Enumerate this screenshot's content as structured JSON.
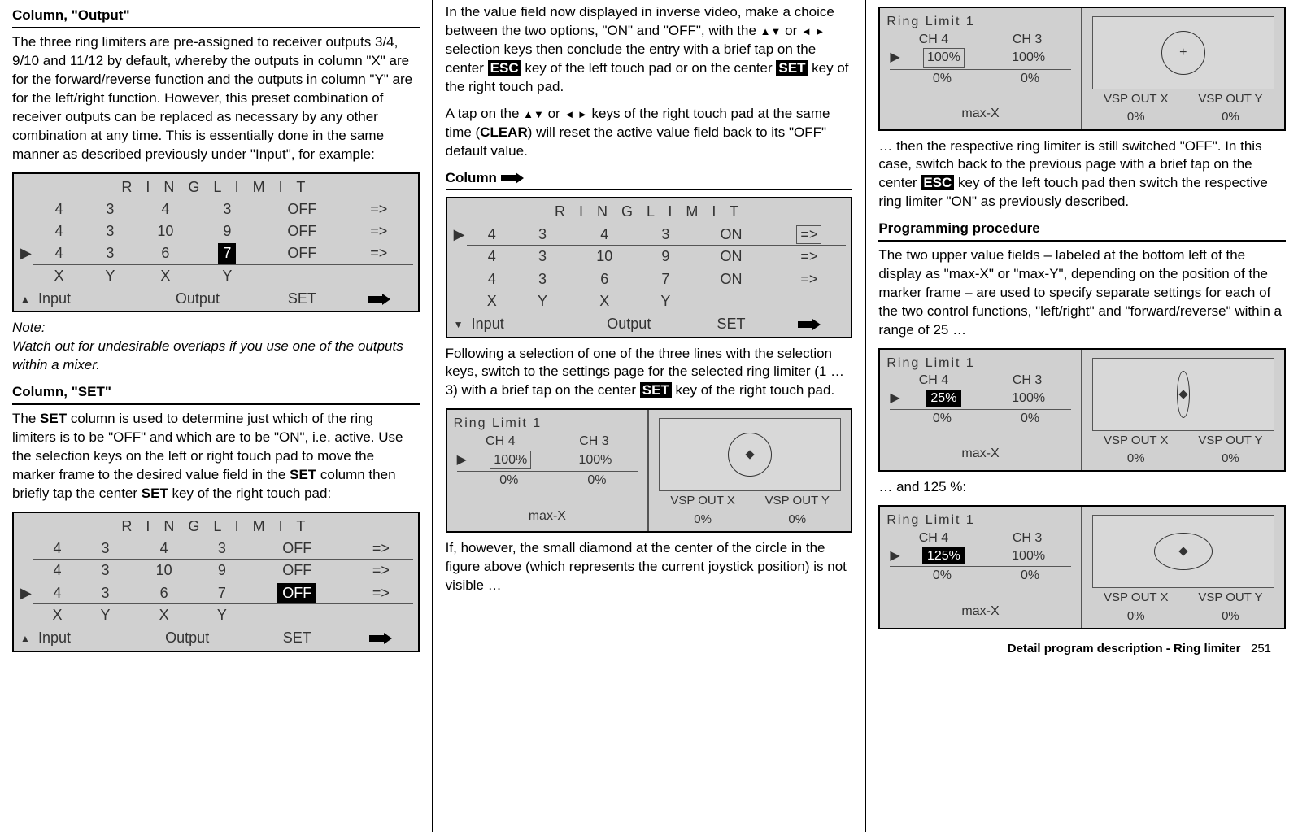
{
  "col1": {
    "head1": "Column, \"Output\"",
    "p1": "The three ring limiters are pre-assigned to receiver outputs 3/4, 9/10 and 11/12 by default, whereby the outputs in column \"X\" are for the forward/reverse function and the outputs in column \"Y\" are for the left/right function. However, this preset combination of receiver outputs can be replaced as necessary by any other combination at any time. This is essentially done in the same manner as described previously under \"Input\", for example:",
    "note_label": "Note:",
    "note_text": "Watch out for undesirable overlaps if you use one of the outputs within a mixer.",
    "head2": "Column, \"SET\"",
    "p2a": "The ",
    "p2b": "SET",
    "p2c": " column is used to determine just which of the ring limiters is to be \"OFF\" and which are to be \"ON\", i.e. active. Use the selection keys on the left or right touch pad to move the marker frame to the desired value field in the ",
    "p2d": "SET",
    "p2e": " column then briefly tap the center ",
    "p2f": "SET",
    "p2g": " key of the right touch pad:"
  },
  "lcd_title": "R I N G   L I M I T",
  "lcd_input": "Input",
  "lcd_output": "Output",
  "lcd_set": "SET",
  "lcd_x": "X",
  "lcd_y": "Y",
  "lcd_arrow": "=>",
  "t1": {
    "r1": {
      "a": "4",
      "b": "3",
      "c": "4",
      "d": "3",
      "e": "OFF"
    },
    "r2": {
      "a": "4",
      "b": "3",
      "c": "10",
      "d": "9",
      "e": "OFF"
    },
    "r3": {
      "a": "4",
      "b": "3",
      "c": "6",
      "d": "7",
      "e": "OFF"
    }
  },
  "t2": {
    "r1": {
      "a": "4",
      "b": "3",
      "c": "4",
      "d": "3",
      "e": "OFF"
    },
    "r2": {
      "a": "4",
      "b": "3",
      "c": "10",
      "d": "9",
      "e": "OFF"
    },
    "r3": {
      "a": "4",
      "b": "3",
      "c": "6",
      "d": "7",
      "e": "OFF"
    }
  },
  "t3": {
    "r1": {
      "a": "4",
      "b": "3",
      "c": "4",
      "d": "3",
      "e": "ON"
    },
    "r2": {
      "a": "4",
      "b": "3",
      "c": "10",
      "d": "9",
      "e": "ON"
    },
    "r3": {
      "a": "4",
      "b": "3",
      "c": "6",
      "d": "7",
      "e": "ON"
    }
  },
  "col2": {
    "p1a": "In the value field now displayed in inverse video, make a choice between the two options, \"ON\" and \"OFF\", with the ",
    "p1b": " or ",
    "p1c": " selection keys then conclude the entry with a brief tap on the center ",
    "esc": "ESC",
    "p1d": " key of the left touch pad or on the center ",
    "set": "SET",
    "p1e": " key of the right touch pad.",
    "p2a": "A tap on the ",
    "p2b": " or ",
    "p2c": " keys of the right touch pad at the same time (",
    "clear": "CLEAR",
    "p2d": ") will reset the active value field back to its \"OFF\" default value.",
    "head_col": "Column ",
    "p3": "Following a selection of one of the three lines with the selection keys, switch to the settings page for the selected ring limiter (1 … 3) with a brief tap on the center ",
    "p3b": " key of the right touch pad.",
    "p4": "If, however, the small diamond at the center of the circle in the figure above (which represents the current joystick position) is not visible …"
  },
  "ringlabels": {
    "title": "Ring Limit  1",
    "ch4": "CH  4",
    "ch3": "CH  3",
    "maxx": "max-X",
    "vspx": "VSP OUT X",
    "vspy": "VSP OUT Y",
    "zero": "0%"
  },
  "rb1": {
    "v1": "100%",
    "v2": "100%",
    "o1": "0%",
    "o2": "0%"
  },
  "rb2": {
    "v1": "100%",
    "v2": "100%",
    "o1": "0%",
    "o2": "0%"
  },
  "rb3": {
    "v1": "25%",
    "v2": "100%",
    "o1": "0%",
    "o2": "0%"
  },
  "rb4": {
    "v1": "125%",
    "v2": "100%",
    "o1": "0%",
    "o2": "0%"
  },
  "col3": {
    "p1a": "… then the respective ring limiter is still switched \"OFF\". In this case, switch back to the previous page with a brief tap on the center ",
    "p1b": " key of the left touch pad then switch the respective ring limiter \"ON\" as previously described.",
    "head": "Programming procedure",
    "p2": "The two upper value fields – labeled at the bottom left of the display as \"max-X\" or \"max-Y\", depending on the position of the marker frame – are used to specify separate settings for each of the two control functions, \"left/right\" and \"forward/reverse\" within a range of 25 …",
    "p3": "… and 125 %:"
  },
  "footer": {
    "text": "Detail program description - Ring limiter",
    "page": "251"
  }
}
